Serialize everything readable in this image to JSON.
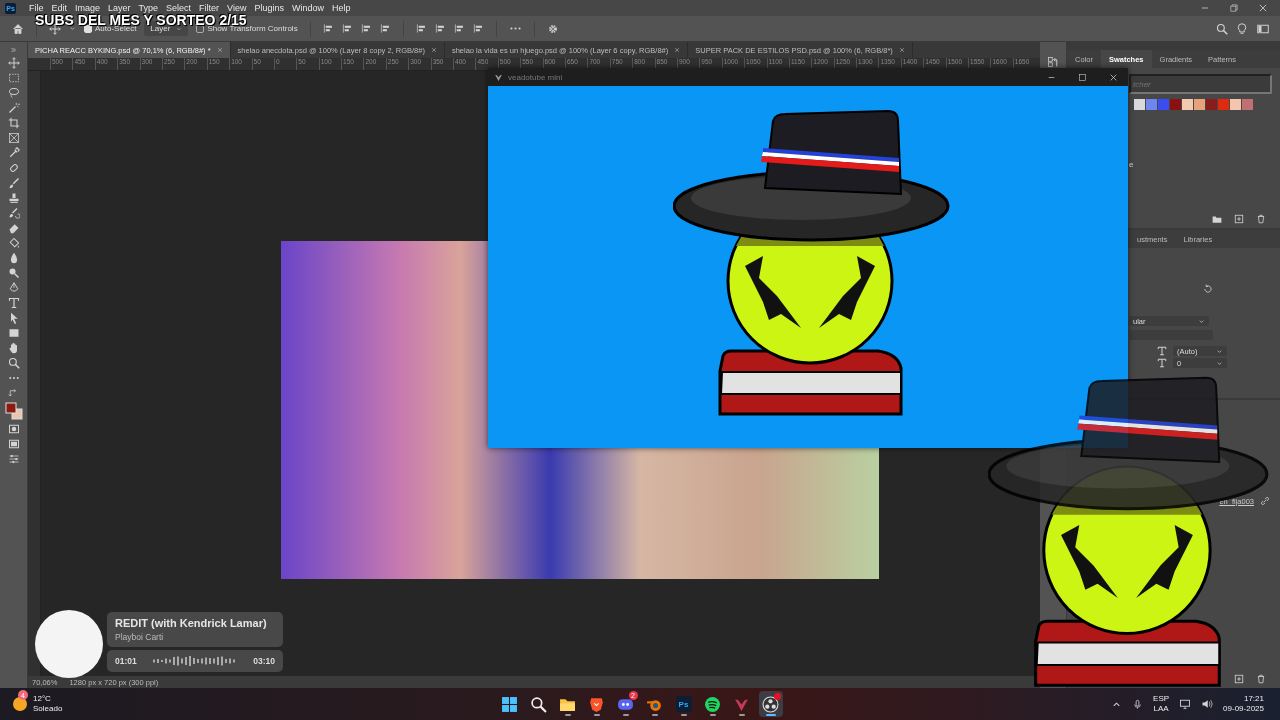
{
  "menubar": {
    "logo": "Ps",
    "items": [
      "File",
      "Edit",
      "Image",
      "Layer",
      "Type",
      "Select",
      "Filter",
      "View",
      "Plugins",
      "Window",
      "Help"
    ]
  },
  "stream_overlay": {
    "title": "SUBS DEL MES Y SORTEO 2/15"
  },
  "options_bar": {
    "auto_select": {
      "label": "Auto-Select",
      "checked": true
    },
    "target": {
      "value": "Layer"
    },
    "transform_controls": {
      "label": "Show Transform Controls",
      "checked": false
    }
  },
  "tabs": [
    {
      "label": "PICHA REACC BYKING.psd @ 70,1% (6, RGB/8#) *",
      "selected": true
    },
    {
      "label": "shelao anecdota.psd @ 100% (Layer 8 copy 2, RGB/8#)",
      "selected": false
    },
    {
      "label": "shelao la vida es un hjuego.psd @ 100% (Layer 6 copy, RGB/8#)",
      "selected": false
    },
    {
      "label": "SUPER PACK DE ESTILOS PSD.psd @ 100% (6, RGB/8*)",
      "selected": false
    }
  ],
  "ruler": {
    "labels": [
      "500",
      "450",
      "400",
      "350",
      "300",
      "250",
      "200",
      "150",
      "100",
      "50",
      "0",
      "50",
      "100",
      "150",
      "200",
      "250",
      "300",
      "350",
      "400",
      "450",
      "500",
      "550",
      "600",
      "650",
      "700",
      "750",
      "800",
      "850",
      "900",
      "950",
      "1000",
      "1050",
      "1100",
      "1150",
      "1200",
      "1250",
      "1300",
      "1350",
      "1400",
      "1450",
      "1500",
      "1550",
      "1600",
      "1650"
    ]
  },
  "veadotube_window": {
    "title": "veadotube mini"
  },
  "swatches_panel": {
    "tabs": [
      {
        "label": "Color",
        "selected": false
      },
      {
        "label": "Swatches",
        "selected": true
      },
      {
        "label": "Gradients",
        "selected": false
      },
      {
        "label": "Patterns",
        "selected": false
      }
    ],
    "search": {
      "placeholder": "tcher"
    },
    "swatches": [
      {
        "color": "#d9d9d9"
      },
      {
        "color": "#6f86f0"
      },
      {
        "color": "#3b4cf0"
      },
      {
        "color": "#8b1010"
      },
      {
        "color": "#f3c9b0"
      },
      {
        "color": "#e8a27a"
      },
      {
        "color": "#8a1c1c"
      },
      {
        "color": "#e02a10"
      },
      {
        "color": "#f5c5b0"
      },
      {
        "color": "#c07070"
      }
    ],
    "group_label": "e"
  },
  "properties_panel": {
    "tabs": [
      {
        "label": "ustments",
        "selected": false
      },
      {
        "label": "Libraries",
        "selected": false
      }
    ],
    "font_style": "ular",
    "leading": "(Auto)",
    "tracking": "0"
  },
  "layers_panel": {
    "layer_name": "en_fija003"
  },
  "status_bar": {
    "zoom": "70,06%",
    "doc_info": "1280 px x 720 px (300 ppi)"
  },
  "music_widget": {
    "title": "REDIT (with Kendrick Lamar)",
    "artist": "Playboi Carti",
    "elapsed": "01:01",
    "duration": "03:10"
  },
  "taskbar": {
    "weather": {
      "badge": "4",
      "temperature": "12°C",
      "condition": "Soleado"
    },
    "apps": [
      {
        "kind": "start",
        "running": false,
        "active": false,
        "notification": false
      },
      {
        "kind": "search",
        "running": false,
        "active": false,
        "notification": false
      },
      {
        "kind": "explorer",
        "running": true,
        "active": false,
        "notification": false
      },
      {
        "kind": "brave",
        "running": true,
        "active": false,
        "notification": false
      },
      {
        "kind": "discord",
        "running": true,
        "active": false,
        "notification": false,
        "badge": "2"
      },
      {
        "kind": "blender",
        "running": true,
        "active": false,
        "notification": false
      },
      {
        "kind": "photoshop",
        "running": true,
        "active": false,
        "notification": false,
        "label": "Ps"
      },
      {
        "kind": "spotify",
        "running": true,
        "active": false,
        "notification": false
      },
      {
        "kind": "veadotube",
        "running": true,
        "active": false,
        "notification": false
      },
      {
        "kind": "obs",
        "running": true,
        "active": true,
        "notification": true
      }
    ],
    "language": "ESP",
    "layout": "LAA",
    "time": "17:21",
    "date": "09-09-2025"
  }
}
